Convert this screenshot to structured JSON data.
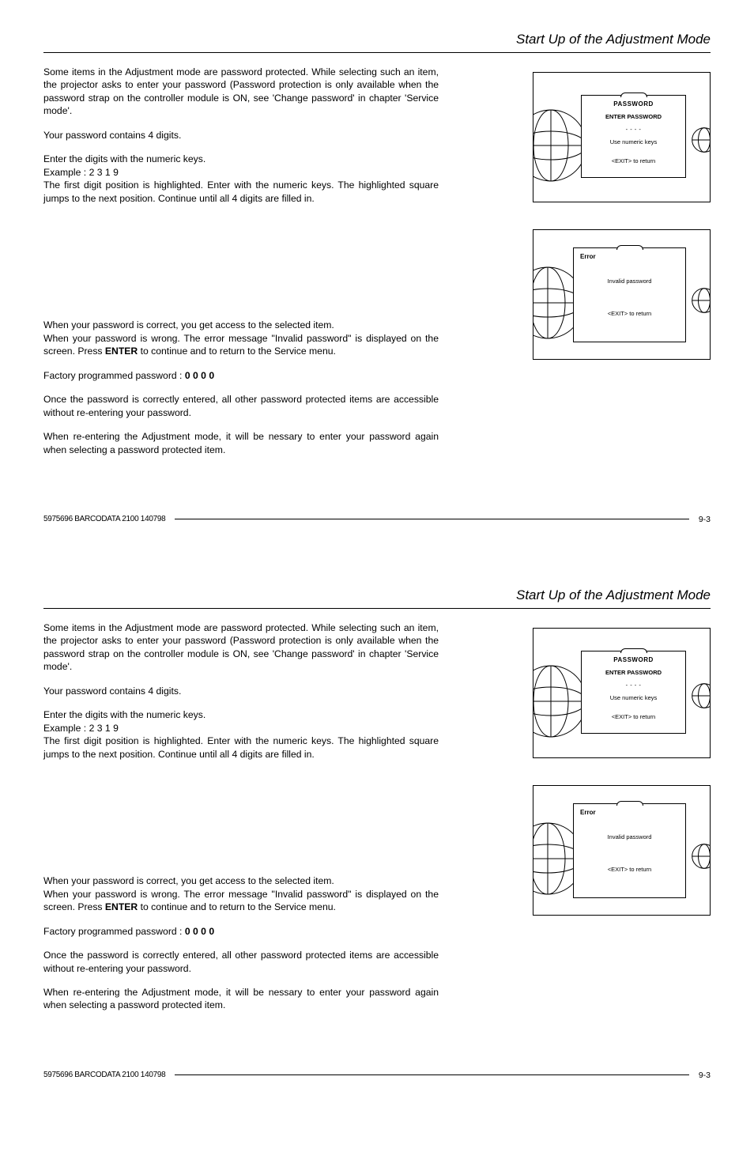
{
  "header": {
    "title": "Start Up of the Adjustment Mode"
  },
  "body": {
    "p1": "Some items in the Adjustment mode are password protected.  While selecting such an item, the projector asks to enter your password (Password protection is only available when the password strap on the controller module is ON, see 'Change password' in chapter 'Service mode'.",
    "p2": "Your password contains 4 digits.",
    "p3": "Enter the digits with the numeric keys.",
    "p4": "Example : 2 3 1 9",
    "p5": "The first digit position is highlighted.  Enter with the numeric keys.  The highlighted square jumps to the next position.  Continue until all 4 digits are filled in.",
    "p6a": "When your password is correct, you get access to the selected item.",
    "p6b_pre": "When your password is wrong.  The error message \"Invalid password\" is displayed on the screen.  Press ",
    "p6b_bold": "ENTER",
    "p6b_post": " to continue and to return to the Service menu.",
    "p7_pre": "Factory programmed password :   ",
    "p7_val": "0 0 0 0",
    "p8": "Once the password is correctly entered, all other password protected items are accessible without re-entering your password.",
    "p9": "When re-entering the Adjustment mode, it will be nessary to enter your password again when selecting a password protected item."
  },
  "osd_pw": {
    "title": "PASSWORD",
    "prompt": "ENTER PASSWORD",
    "dashes": "- - - -",
    "hint": "Use numeric keys",
    "exit": "<EXIT> to return"
  },
  "osd_err": {
    "label": "Error",
    "msg": "Invalid password",
    "exit": "<EXIT> to return"
  },
  "footer": {
    "docid": "5975696 BARCODATA 2100 140798",
    "page": "9-3"
  }
}
